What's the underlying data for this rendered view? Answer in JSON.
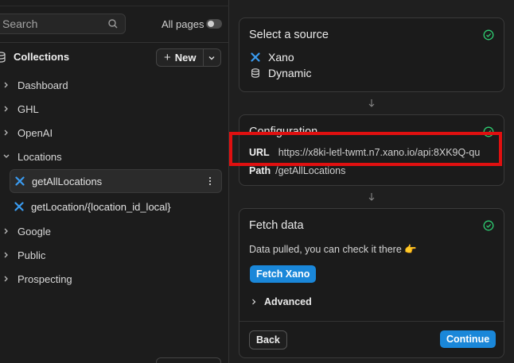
{
  "sidebar": {
    "search": {
      "placeholder": "Search"
    },
    "all_pages_label": "All pages",
    "collections_label": "Collections",
    "new_button_label": "New",
    "items": [
      {
        "label": "Dashboard"
      },
      {
        "label": "GHL"
      },
      {
        "label": "OpenAI"
      },
      {
        "label": "Locations"
      },
      {
        "label": "Google"
      },
      {
        "label": "Public"
      },
      {
        "label": "Prospecting"
      }
    ],
    "location_children": [
      {
        "label": "getAllLocations",
        "active": true
      },
      {
        "label": "getLocation/{location_id_local}",
        "active": false
      }
    ]
  },
  "source_card": {
    "title": "Select a source",
    "options": [
      {
        "label": "Xano",
        "icon": "xano-x-icon"
      },
      {
        "label": "Dynamic",
        "icon": "database-icon"
      }
    ]
  },
  "config_card": {
    "title": "Configuration",
    "url_key": "URL",
    "url_value": "https://x8ki-letl-twmt.n7.xano.io/api:8XK9Q-qu",
    "path_key": "Path",
    "path_value": "/getAllLocations"
  },
  "fetch_card": {
    "title": "Fetch data",
    "description": "Data pulled, you can check it there 👉",
    "fetch_button": "Fetch Xano",
    "advanced_label": "Advanced",
    "back_button": "Back",
    "continue_button": "Continue"
  },
  "colors": {
    "accent": "#1a87d9",
    "success": "#2ecc71",
    "highlight": "#e01010",
    "xano_icon": "#3a9bf0"
  }
}
